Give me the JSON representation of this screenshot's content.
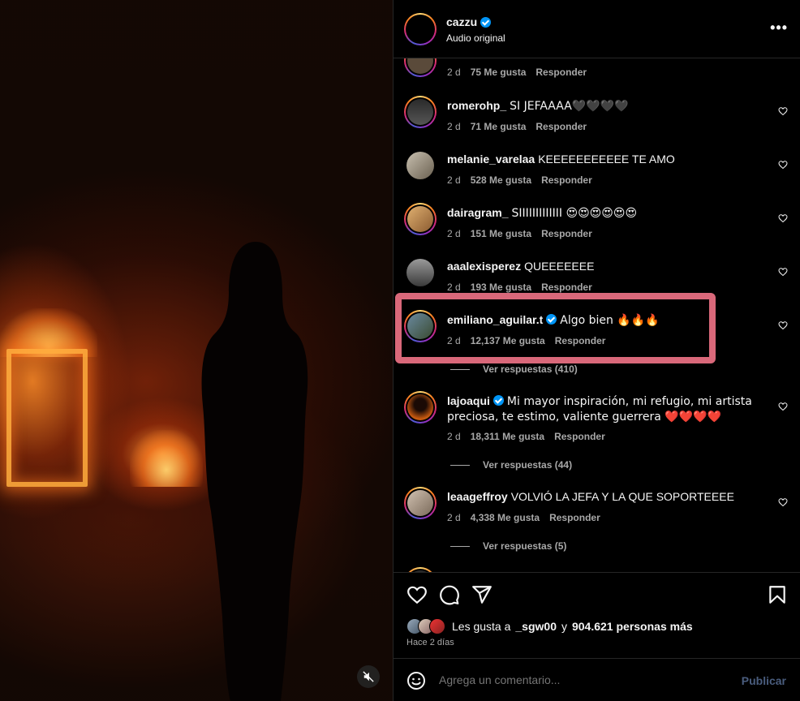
{
  "header": {
    "username": "cazzu",
    "subtitle": "Audio original",
    "more": "•••"
  },
  "comments": [
    {
      "user": "",
      "text": "",
      "time": "2 d",
      "likes": "75 Me gusta",
      "reply": "Responder"
    },
    {
      "user": "romerohp_",
      "text": "SI JEFAAAA🖤🖤🖤🖤",
      "time": "2 d",
      "likes": "71 Me gusta",
      "reply": "Responder"
    },
    {
      "user": "melanie_varelaa",
      "text": "KEEEEEEEEEEE TE AMO",
      "time": "2 d",
      "likes": "528 Me gusta",
      "reply": "Responder"
    },
    {
      "user": "dairagram_",
      "text": "SIIIIIIIIIIIII 😍😍😍😍😍😍",
      "time": "2 d",
      "likes": "151 Me gusta",
      "reply": "Responder"
    },
    {
      "user": "aaalexisperez",
      "text": "QUEEEEEEE",
      "time": "2 d",
      "likes": "193 Me gusta",
      "reply": "Responder"
    },
    {
      "user": "emiliano_aguilar.t",
      "text": "Algo bien 🔥🔥🔥",
      "time": "2 d",
      "likes": "12,137 Me gusta",
      "reply": "Responder",
      "view_replies": "Ver respuestas (410)"
    },
    {
      "user": "lajoaqui",
      "text": "Mi mayor inspiración, mi refugio, mi artista preciosa, te estimo, valiente guerrera ❤️❤️❤️❤️",
      "time": "2 d",
      "likes": "18,311 Me gusta",
      "reply": "Responder",
      "view_replies": "Ver respuestas (44)"
    },
    {
      "user": "leaageffroy",
      "text": "VOLVIÓ LA JEFA Y LA QUE SOPORTEEEE",
      "time": "2 d",
      "likes": "4,338 Me gusta",
      "reply": "Responder",
      "view_replies": "Ver respuestas (5)"
    }
  ],
  "likes": {
    "prefix": "Les gusta a",
    "user": "_sgw00",
    "connector": "y",
    "count": "904.621 personas más"
  },
  "time_ago": "Hace 2 días",
  "add_comment": {
    "placeholder": "Agrega un comentario...",
    "publish": "Publicar"
  },
  "colors": {
    "highlight": "#d9687a",
    "verified": "#0095f6",
    "publish": "#4a5d7e"
  }
}
